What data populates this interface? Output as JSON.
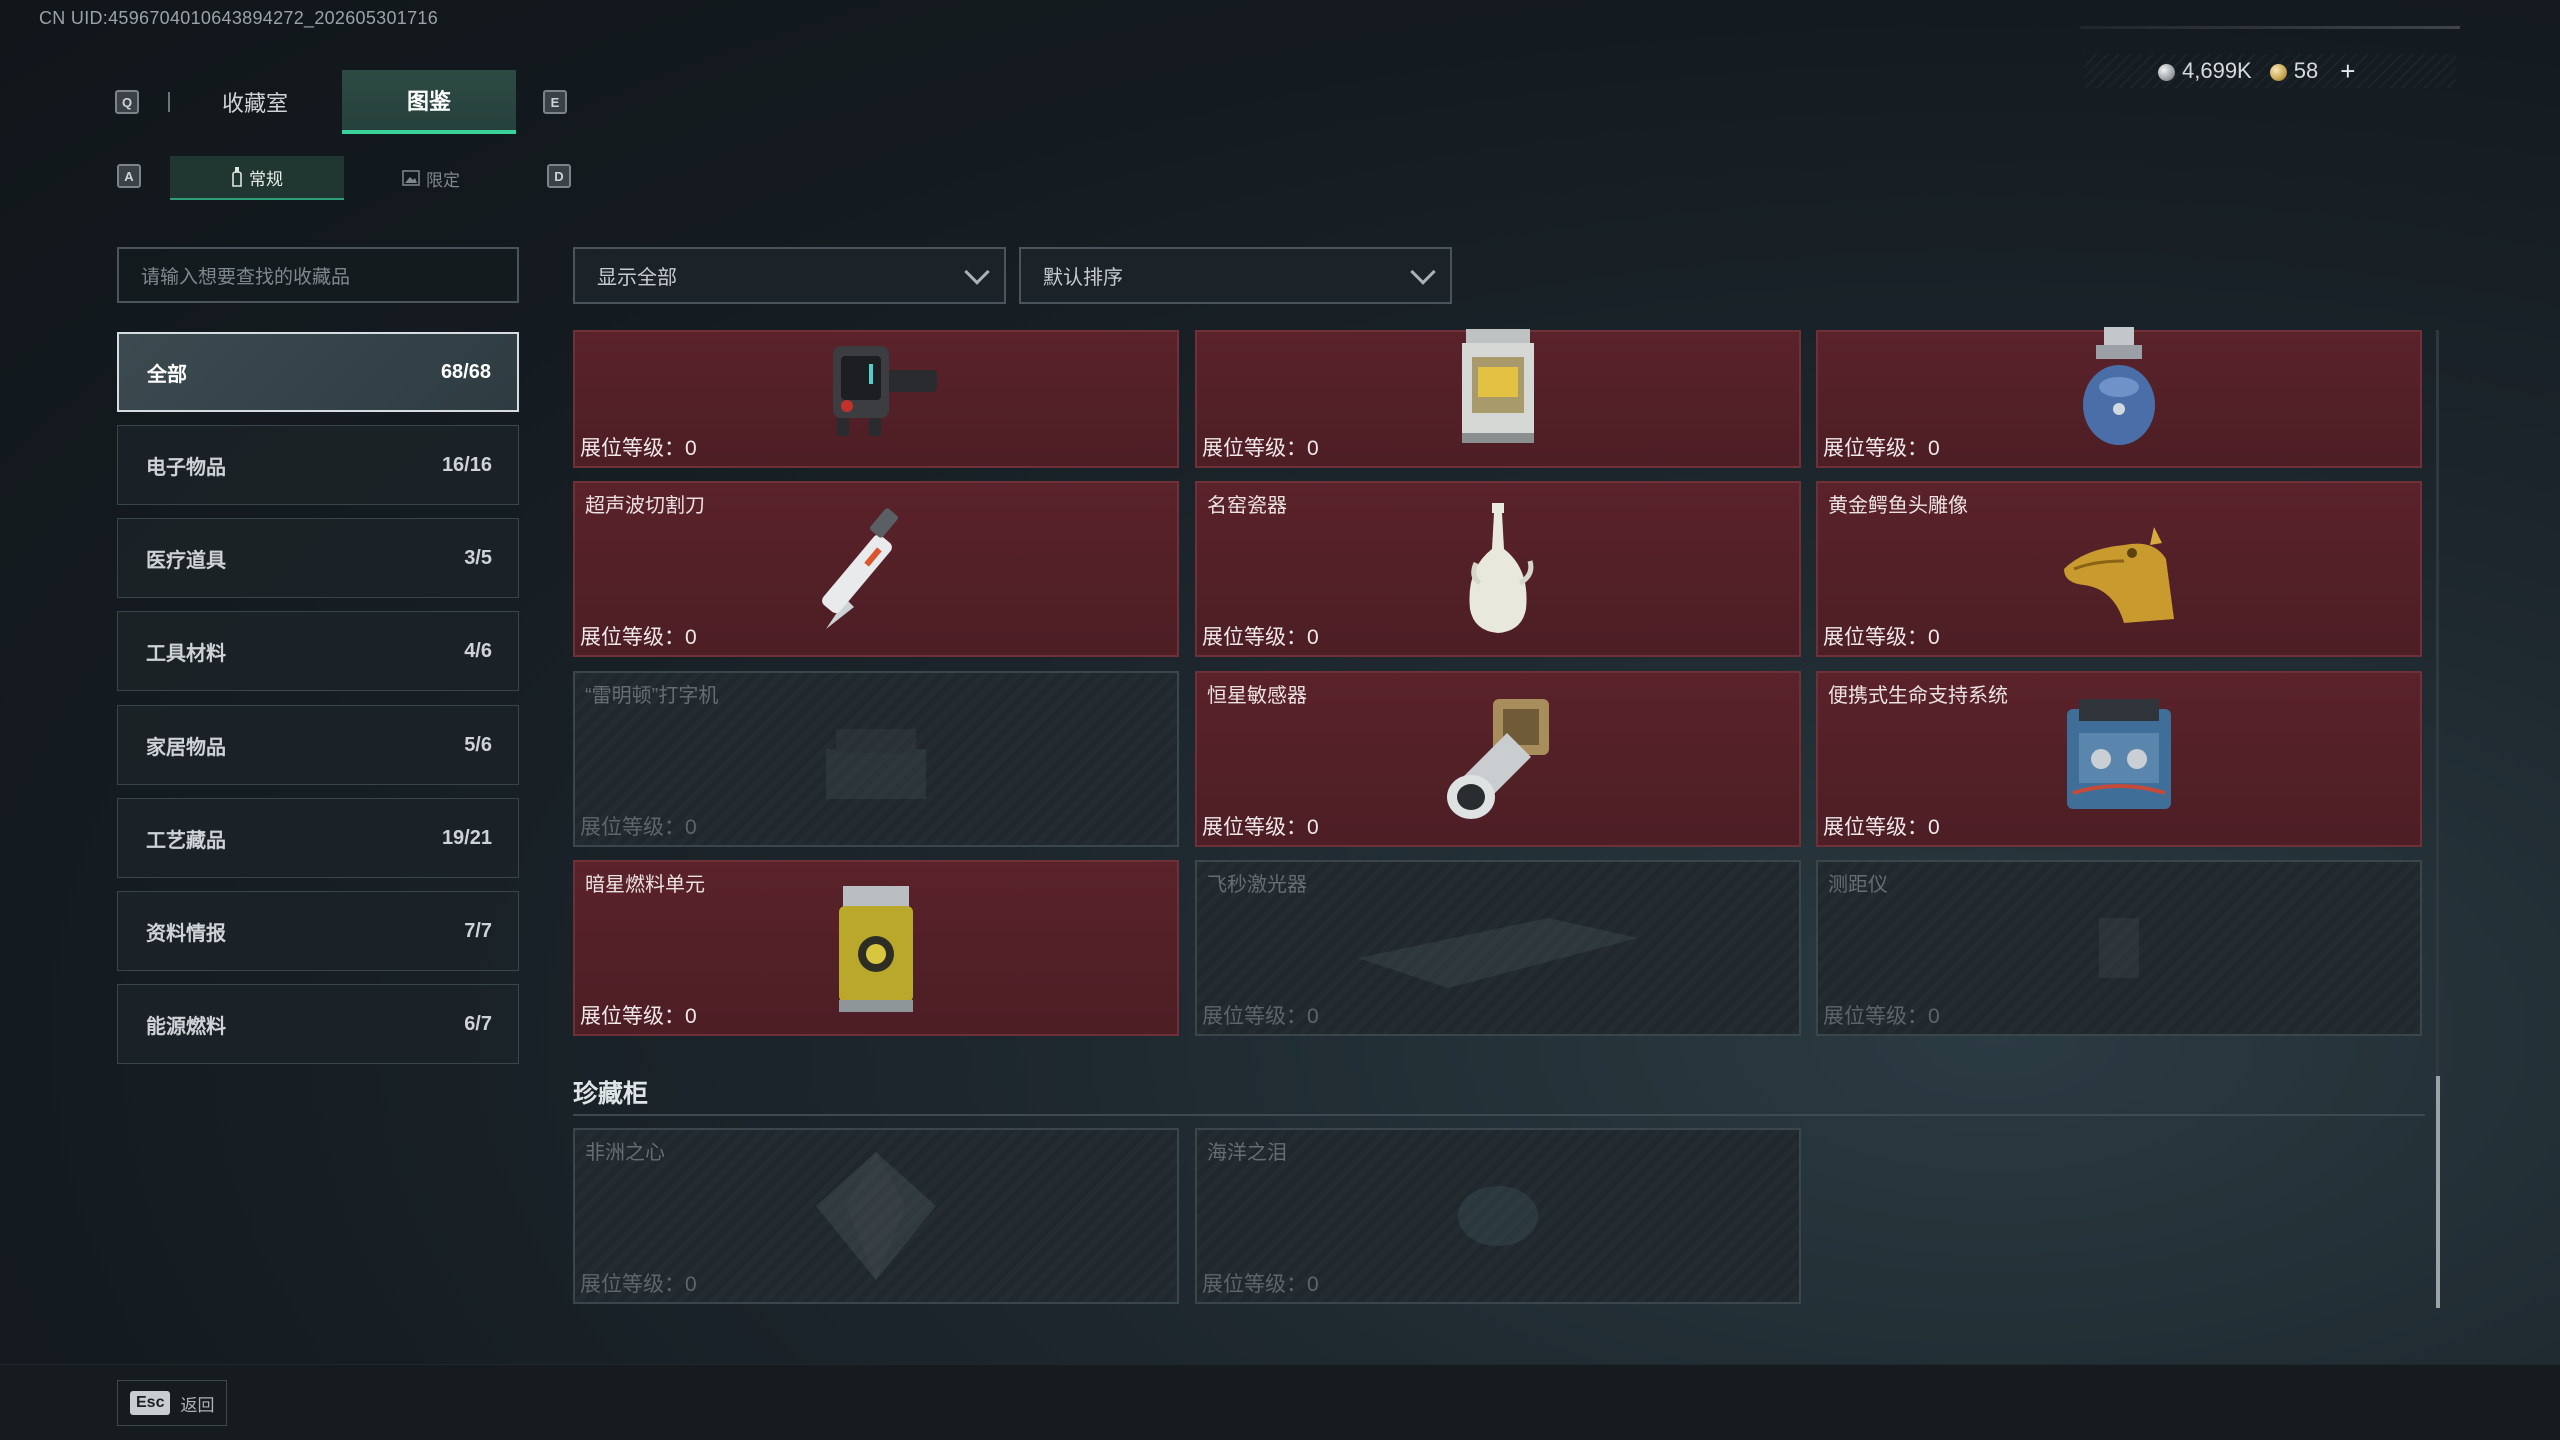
{
  "uid": "CN UID:4596704010643894272_202605301716",
  "currency": {
    "silver": "4,699K",
    "gold": "58"
  },
  "keys": {
    "prev_main": "Q",
    "next_main": "E",
    "prev_sub": "A",
    "next_sub": "D"
  },
  "main_tabs": [
    {
      "label": "收藏室",
      "active": false
    },
    {
      "label": "图鉴",
      "active": true
    }
  ],
  "sub_tabs": [
    {
      "label": "常规",
      "active": true
    },
    {
      "label": "限定",
      "active": false
    }
  ],
  "search": {
    "placeholder": "请输入想要查找的收藏品"
  },
  "categories": [
    {
      "label": "全部",
      "count": "68/68",
      "active": true
    },
    {
      "label": "电子物品",
      "count": "16/16"
    },
    {
      "label": "医疗道具",
      "count": "3/5"
    },
    {
      "label": "工具材料",
      "count": "4/6"
    },
    {
      "label": "家居物品",
      "count": "5/6"
    },
    {
      "label": "工艺藏品",
      "count": "19/21"
    },
    {
      "label": "资料情报",
      "count": "7/7"
    },
    {
      "label": "能源燃料",
      "count": "6/7"
    }
  ],
  "filters": {
    "show": "显示全部",
    "sort": "默认排序"
  },
  "level_prefix": "展位等级：",
  "items": [
    {
      "name": "",
      "level": "0",
      "owned": true,
      "icon": "wrist-device-icon"
    },
    {
      "name": "",
      "level": "0",
      "owned": true,
      "icon": "lantern-icon"
    },
    {
      "name": "",
      "level": "0",
      "owned": true,
      "icon": "gas-canister-icon"
    },
    {
      "name": "超声波切割刀",
      "level": "0",
      "owned": true,
      "icon": "ultrasonic-knife-icon"
    },
    {
      "name": "名窑瓷器",
      "level": "0",
      "owned": true,
      "icon": "porcelain-vase-icon"
    },
    {
      "name": "黄金鳄鱼头雕像",
      "level": "0",
      "owned": true,
      "icon": "gold-crocodile-icon"
    },
    {
      "name": "“雷明顿”打字机",
      "level": "0",
      "owned": false,
      "icon": "typewriter-icon"
    },
    {
      "name": "恒星敏感器",
      "level": "0",
      "owned": true,
      "icon": "star-sensor-icon"
    },
    {
      "name": "便携式生命支持系统",
      "level": "0",
      "owned": true,
      "icon": "life-support-icon"
    },
    {
      "name": "暗星燃料单元",
      "level": "0",
      "owned": true,
      "icon": "fuel-cell-icon"
    },
    {
      "name": "飞秒激光器",
      "level": "0",
      "owned": false,
      "icon": "laser-icon"
    },
    {
      "name": "测距仪",
      "level": "0",
      "owned": false,
      "icon": "rangefinder-icon"
    }
  ],
  "treasure_section": {
    "title": "珍藏柜",
    "items": [
      {
        "name": "非洲之心",
        "level": "0",
        "owned": false,
        "icon": "diamond-icon"
      },
      {
        "name": "海洋之泪",
        "level": "0",
        "owned": false,
        "icon": "gem-icon"
      }
    ]
  },
  "footer": {
    "key": "Esc",
    "label": "返回"
  }
}
